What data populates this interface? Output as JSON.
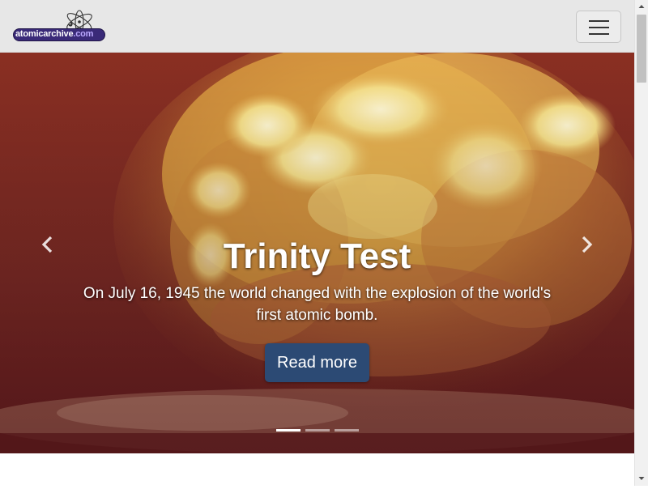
{
  "navbar": {
    "brand": {
      "name_part1": "atomicarchive",
      "name_dot": ".",
      "name_part2": "com",
      "logo_icon": "atom-icon"
    },
    "toggle_icon": "hamburger-menu-icon",
    "background_color": "#e7e7e7"
  },
  "carousel": {
    "slide": {
      "title": "Trinity Test",
      "text": "On July 16, 1945 the world changed with the explosion of the world's first atomic bomb.",
      "button_label": "Read more",
      "image_subject": "nuclear-fireball-photo"
    },
    "prev_icon": "chevron-left-icon",
    "next_icon": "chevron-right-icon",
    "slide_count": 3,
    "active_slide": 1,
    "button_color": "#2c4a74"
  },
  "scrollbar": {
    "up_icon": "scroll-up-arrow-icon",
    "down_icon": "scroll-down-arrow-icon"
  }
}
